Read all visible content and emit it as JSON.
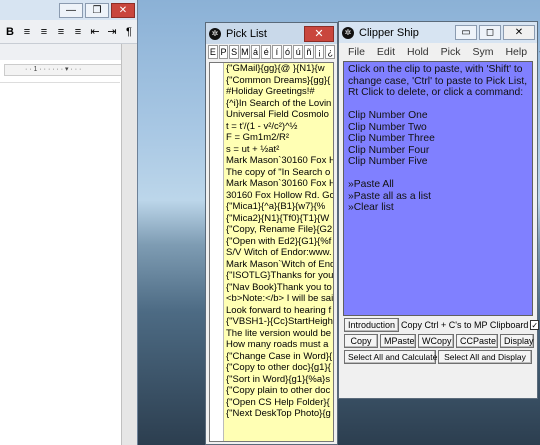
{
  "word": {
    "buttons": [
      "B"
    ],
    "close": "×",
    "ruler": "· · 1 · · · · · · ▾ · · ·"
  },
  "pick": {
    "title": "Pick List",
    "close": "✕",
    "charbar": [
      "E",
      "P",
      "S",
      "M",
      "á",
      "é",
      "í",
      "ó",
      "ú",
      "ñ",
      "¡",
      "¿"
    ],
    "items": [
      "{\"GMail}{gg}{@ }{N1}{w",
      "{\"Common Dreams}{gg}{",
      "#Holiday Greetings!#",
      "{^i}In Search of the Lovin",
      "Universal Field Cosmolo",
      "t = t'/(1 - v²/c²)^½",
      "F = Gm1m2/R²",
      "s = ut + ½at²",
      "Mark Mason`30160 Fox H",
      "The copy of \"In Search o",
      "Mark Mason`30160 Fox H",
      "30160 Fox Hollow Rd. Go",
      "{\"Mica1}{^a}{B1}{w7}{%",
      "{\"Mica2}{N1}{Tf0}{T1}{W",
      "{\"Copy, Rename File}{G2",
      "{\"Open with Ed2}{G1}{%f",
      "S/V Witch of Endor:www.",
      "Mark Mason`Witch of End",
      "{\"ISOTLG}Thanks for you",
      "{\"Nav Book}Thank you to",
      "<b>Note:</b> I will be sai",
      "Look forward to hearing f",
      "{\"VBSH1-}{Cc}StartHeigh",
      "The lite version would be",
      "How many roads must a",
      "{\"Change Case in Word}{",
      "{\"Copy to other doc}{g1}{",
      "{\"Sort in Word}{g1}{%a}s",
      "{\"Copy plain to other doc",
      "{\"Open CS Help Folder}{",
      "{\"Next DeskTop Photo}{g"
    ]
  },
  "clip": {
    "title": "Clipper Ship",
    "caps": {
      "min": "▭",
      "max": "◻",
      "close": "✕"
    },
    "menu": [
      "File",
      "Edit",
      "Hold",
      "Pick",
      "Sym",
      "Help",
      "<<"
    ],
    "instructions": [
      "Click on the clip to paste, with 'Shift' to",
      "change case, 'Ctrl' to paste to Pick List,",
      "Rt Click to delete, or click a command:"
    ],
    "clips": [
      "Clip Number One",
      "Clip Number Two",
      "Clip Number Three",
      "Clip Number Four",
      "Clip Number Five"
    ],
    "commands": [
      "»Paste All",
      "»Paste all as a list",
      "»Clear list"
    ],
    "intro_button": "Introduction",
    "ctrl_label": "Copy Ctrl + C's to  MP Clipboard",
    "checkbox": "✓",
    "row2": [
      "Copy",
      "MPaste",
      "WCopy",
      "CCPaste",
      "Display"
    ],
    "row3": [
      "Select All and Calculate",
      "Select All and Display"
    ]
  }
}
